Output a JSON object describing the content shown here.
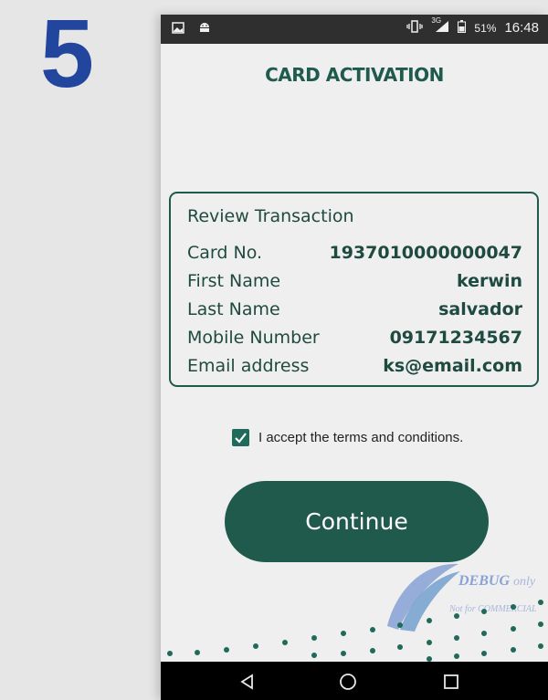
{
  "step": {
    "number": "5"
  },
  "status_bar": {
    "network": "3G",
    "battery": "51%",
    "time": "16:48"
  },
  "app": {
    "title": "CARD ACTIVATION"
  },
  "review": {
    "heading": "Review Transaction",
    "rows": [
      {
        "label": "Card No.",
        "value": "1937010000000047"
      },
      {
        "label": "First Name",
        "value": "kerwin"
      },
      {
        "label": "Last Name",
        "value": "salvador"
      },
      {
        "label": "Mobile Number",
        "value": "09171234567"
      },
      {
        "label": "Email address",
        "value": "ks@email.com"
      }
    ]
  },
  "terms": {
    "label": "I accept the terms and conditions.",
    "checked": true
  },
  "continue_label": "Continue",
  "watermark": {
    "title": "DEBUG",
    "suffix": "only",
    "subtitle": "Not for COMMERCIAL"
  },
  "colors": {
    "primary": "#1f5a4d",
    "step": "#22459d",
    "status_bar": "#2f2f2f",
    "nav_bar": "#000000"
  },
  "icons": {
    "status_left": [
      "image-icon",
      "android-icon"
    ],
    "status_right": [
      "vibrate-icon",
      "signal-icon",
      "battery-icon"
    ],
    "nav": [
      "back-icon",
      "home-icon",
      "recents-icon"
    ]
  }
}
